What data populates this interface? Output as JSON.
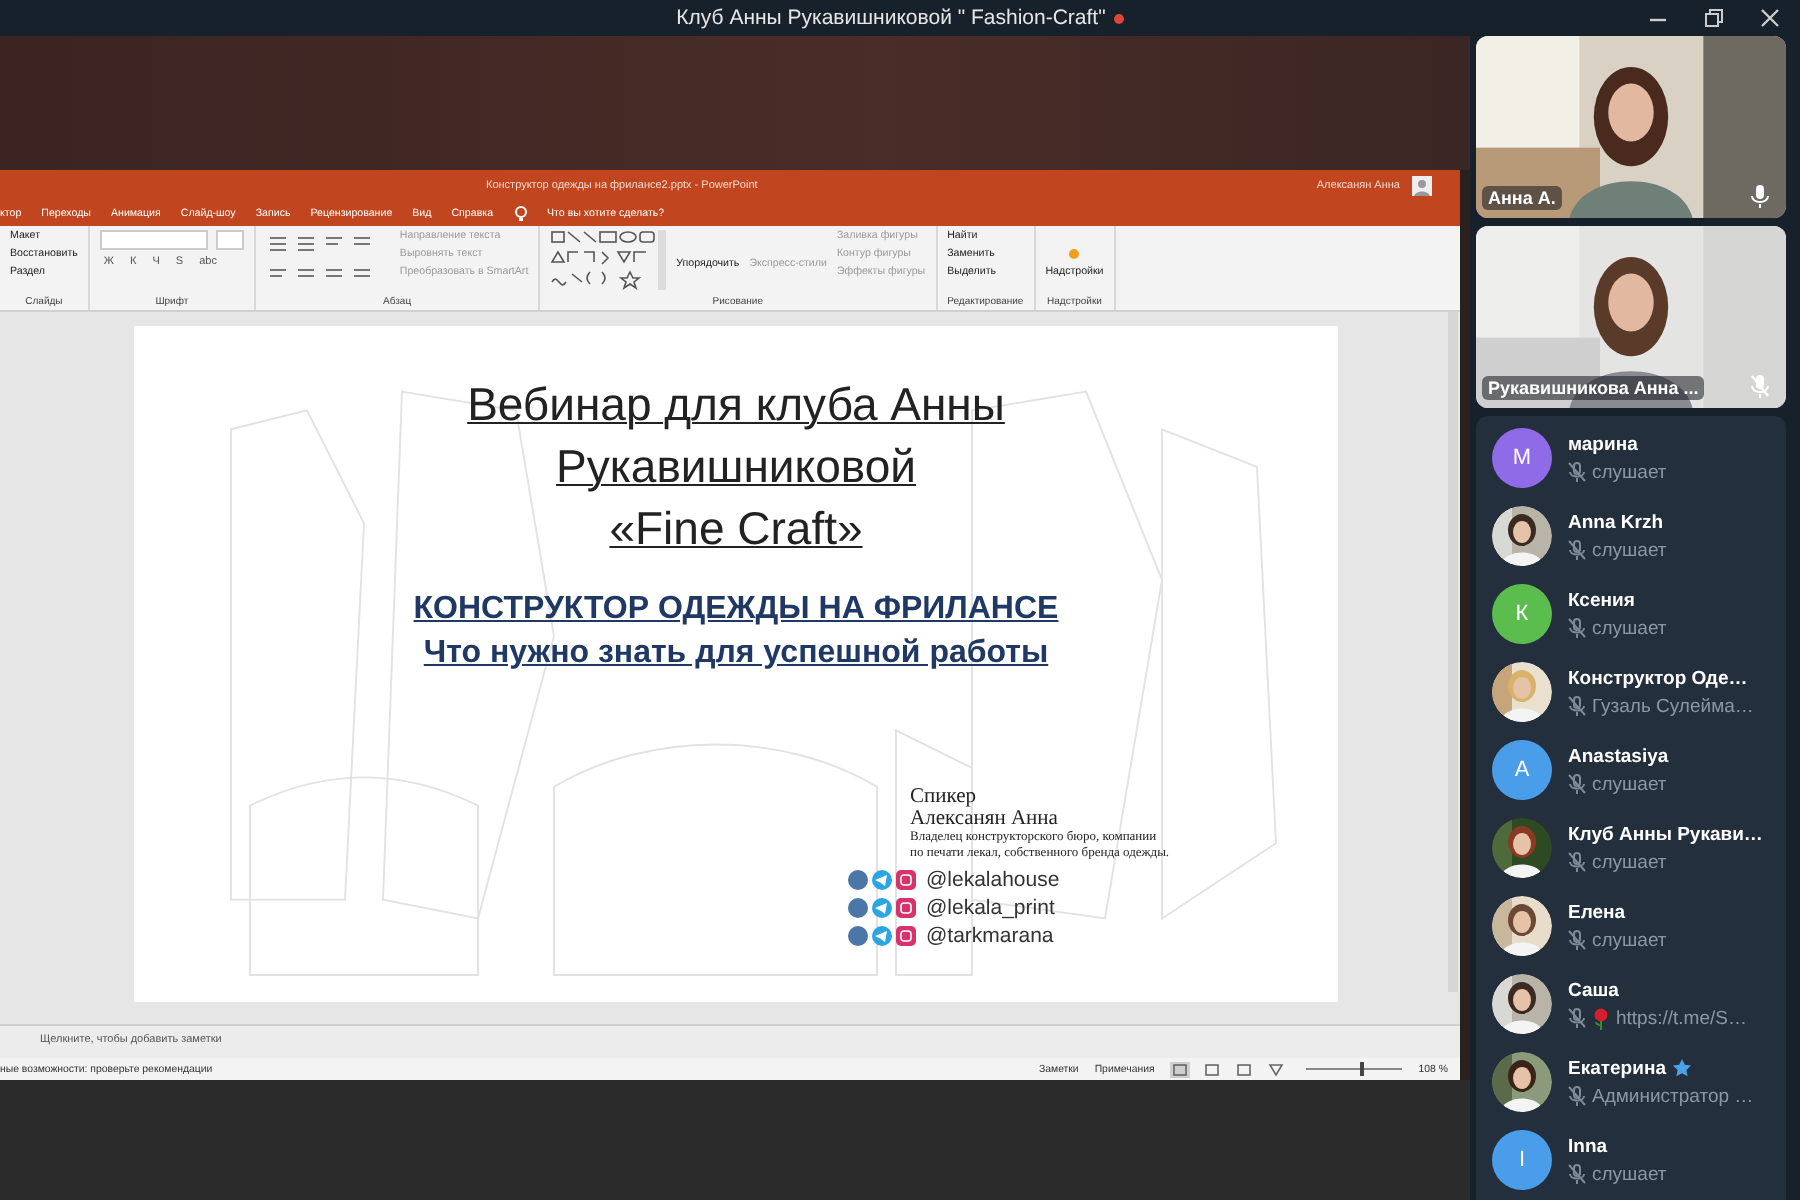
{
  "window": {
    "title": "Клуб Анны Рукавишниковой \" Fashion-Craft\"",
    "recording": true
  },
  "powerpoint": {
    "title": "Конструктор одежды на фрилансе2.pptx - PowerPoint",
    "user": "Алексанян Анна",
    "tabs": [
      {
        "label": "ктор",
        "selected": false
      },
      {
        "label": "Переходы",
        "selected": false
      },
      {
        "label": "Анимация",
        "selected": false
      },
      {
        "label": "Слайд-шоу",
        "selected": false
      },
      {
        "label": "Запись",
        "selected": false
      },
      {
        "label": "Рецензирование",
        "selected": false
      },
      {
        "label": "Вид",
        "selected": false
      },
      {
        "label": "Справка",
        "selected": false
      }
    ],
    "tell_me": "Что вы хотите сделать?",
    "ribbon": {
      "slides": {
        "items": [
          "Макет",
          "Восстановить",
          "Раздел"
        ],
        "label": "Слайды"
      },
      "font": {
        "buttons": [
          "Ж",
          "К",
          "Ч",
          "S",
          "abc"
        ],
        "label": "Шрифт"
      },
      "paragraph": {
        "items": [
          "Направление текста",
          "Выровнять текст",
          "Преобразовать в SmartArt"
        ],
        "label": "Абзац"
      },
      "drawing": {
        "arrange": "Упорядочить",
        "styles": "Экспресс-стили",
        "items": [
          "Заливка фигуры",
          "Контур фигуры",
          "Эффекты фигуры"
        ],
        "label": "Рисование"
      },
      "editing": {
        "items": [
          "Найти",
          "Заменить",
          "Выделить"
        ],
        "label": "Редактирование"
      },
      "addins": {
        "button": "Надстройки",
        "label": "Надстройки"
      }
    },
    "slide": {
      "title_lines": [
        "Вебинар для клуба Анны",
        "Рукавишниковой",
        "«Fine Craft»"
      ],
      "heading": "КОНСТРУКТОР ОДЕЖДЫ НА ФРИЛАНСЕ",
      "subheading": "Что нужно знать для успешной работы",
      "speaker_label": "Спикер",
      "speaker_name": "Алексанян Анна",
      "speaker_bio": "Владелец конструкторского бюро, компании по печати лекал, собственного бренда одежды.",
      "handles": [
        "@lekalahouse",
        "@lekala_print",
        "@tarkmarana"
      ]
    },
    "notes_placeholder": "Щелкните, чтобы добавить заметки",
    "status": {
      "accessibility": "ные возможности: проверьте рекомендации",
      "notes": "Заметки",
      "comments": "Примечания",
      "zoom": "108 %",
      "level": 0.55
    }
  },
  "videos": [
    {
      "name": "Анна А.",
      "muted": false
    },
    {
      "name": "Рукавишникова Анна ...",
      "muted": true
    }
  ],
  "participants": [
    {
      "name": "марина",
      "status": "слушает",
      "kind": "letter",
      "letter": "М",
      "color": "#8f6be8"
    },
    {
      "name": "Anna Krzh",
      "status": "слушает"
    },
    {
      "name": "Ксения",
      "status": "слушает",
      "kind": "letter",
      "letter": "К",
      "color": "#5bbd4e"
    },
    {
      "name": "Конструктор Оде…",
      "status": "Гузаль Сулейма…"
    },
    {
      "name": "Anastasiya",
      "status": "слушает",
      "kind": "letter",
      "letter": "А",
      "color": "#4a9de8"
    },
    {
      "name": "Клуб Анны Рукави…",
      "status": "слушает"
    },
    {
      "name": "Елена",
      "status": "слушает"
    },
    {
      "name": "Саша",
      "status": "https://t.me/S…",
      "flower": true
    },
    {
      "name": "Екатерина",
      "status": "Администратор …",
      "starred": true
    },
    {
      "name": "Inna",
      "status": "слушает",
      "kind": "letter",
      "letter": "I",
      "color": "#4a9de8"
    }
  ]
}
